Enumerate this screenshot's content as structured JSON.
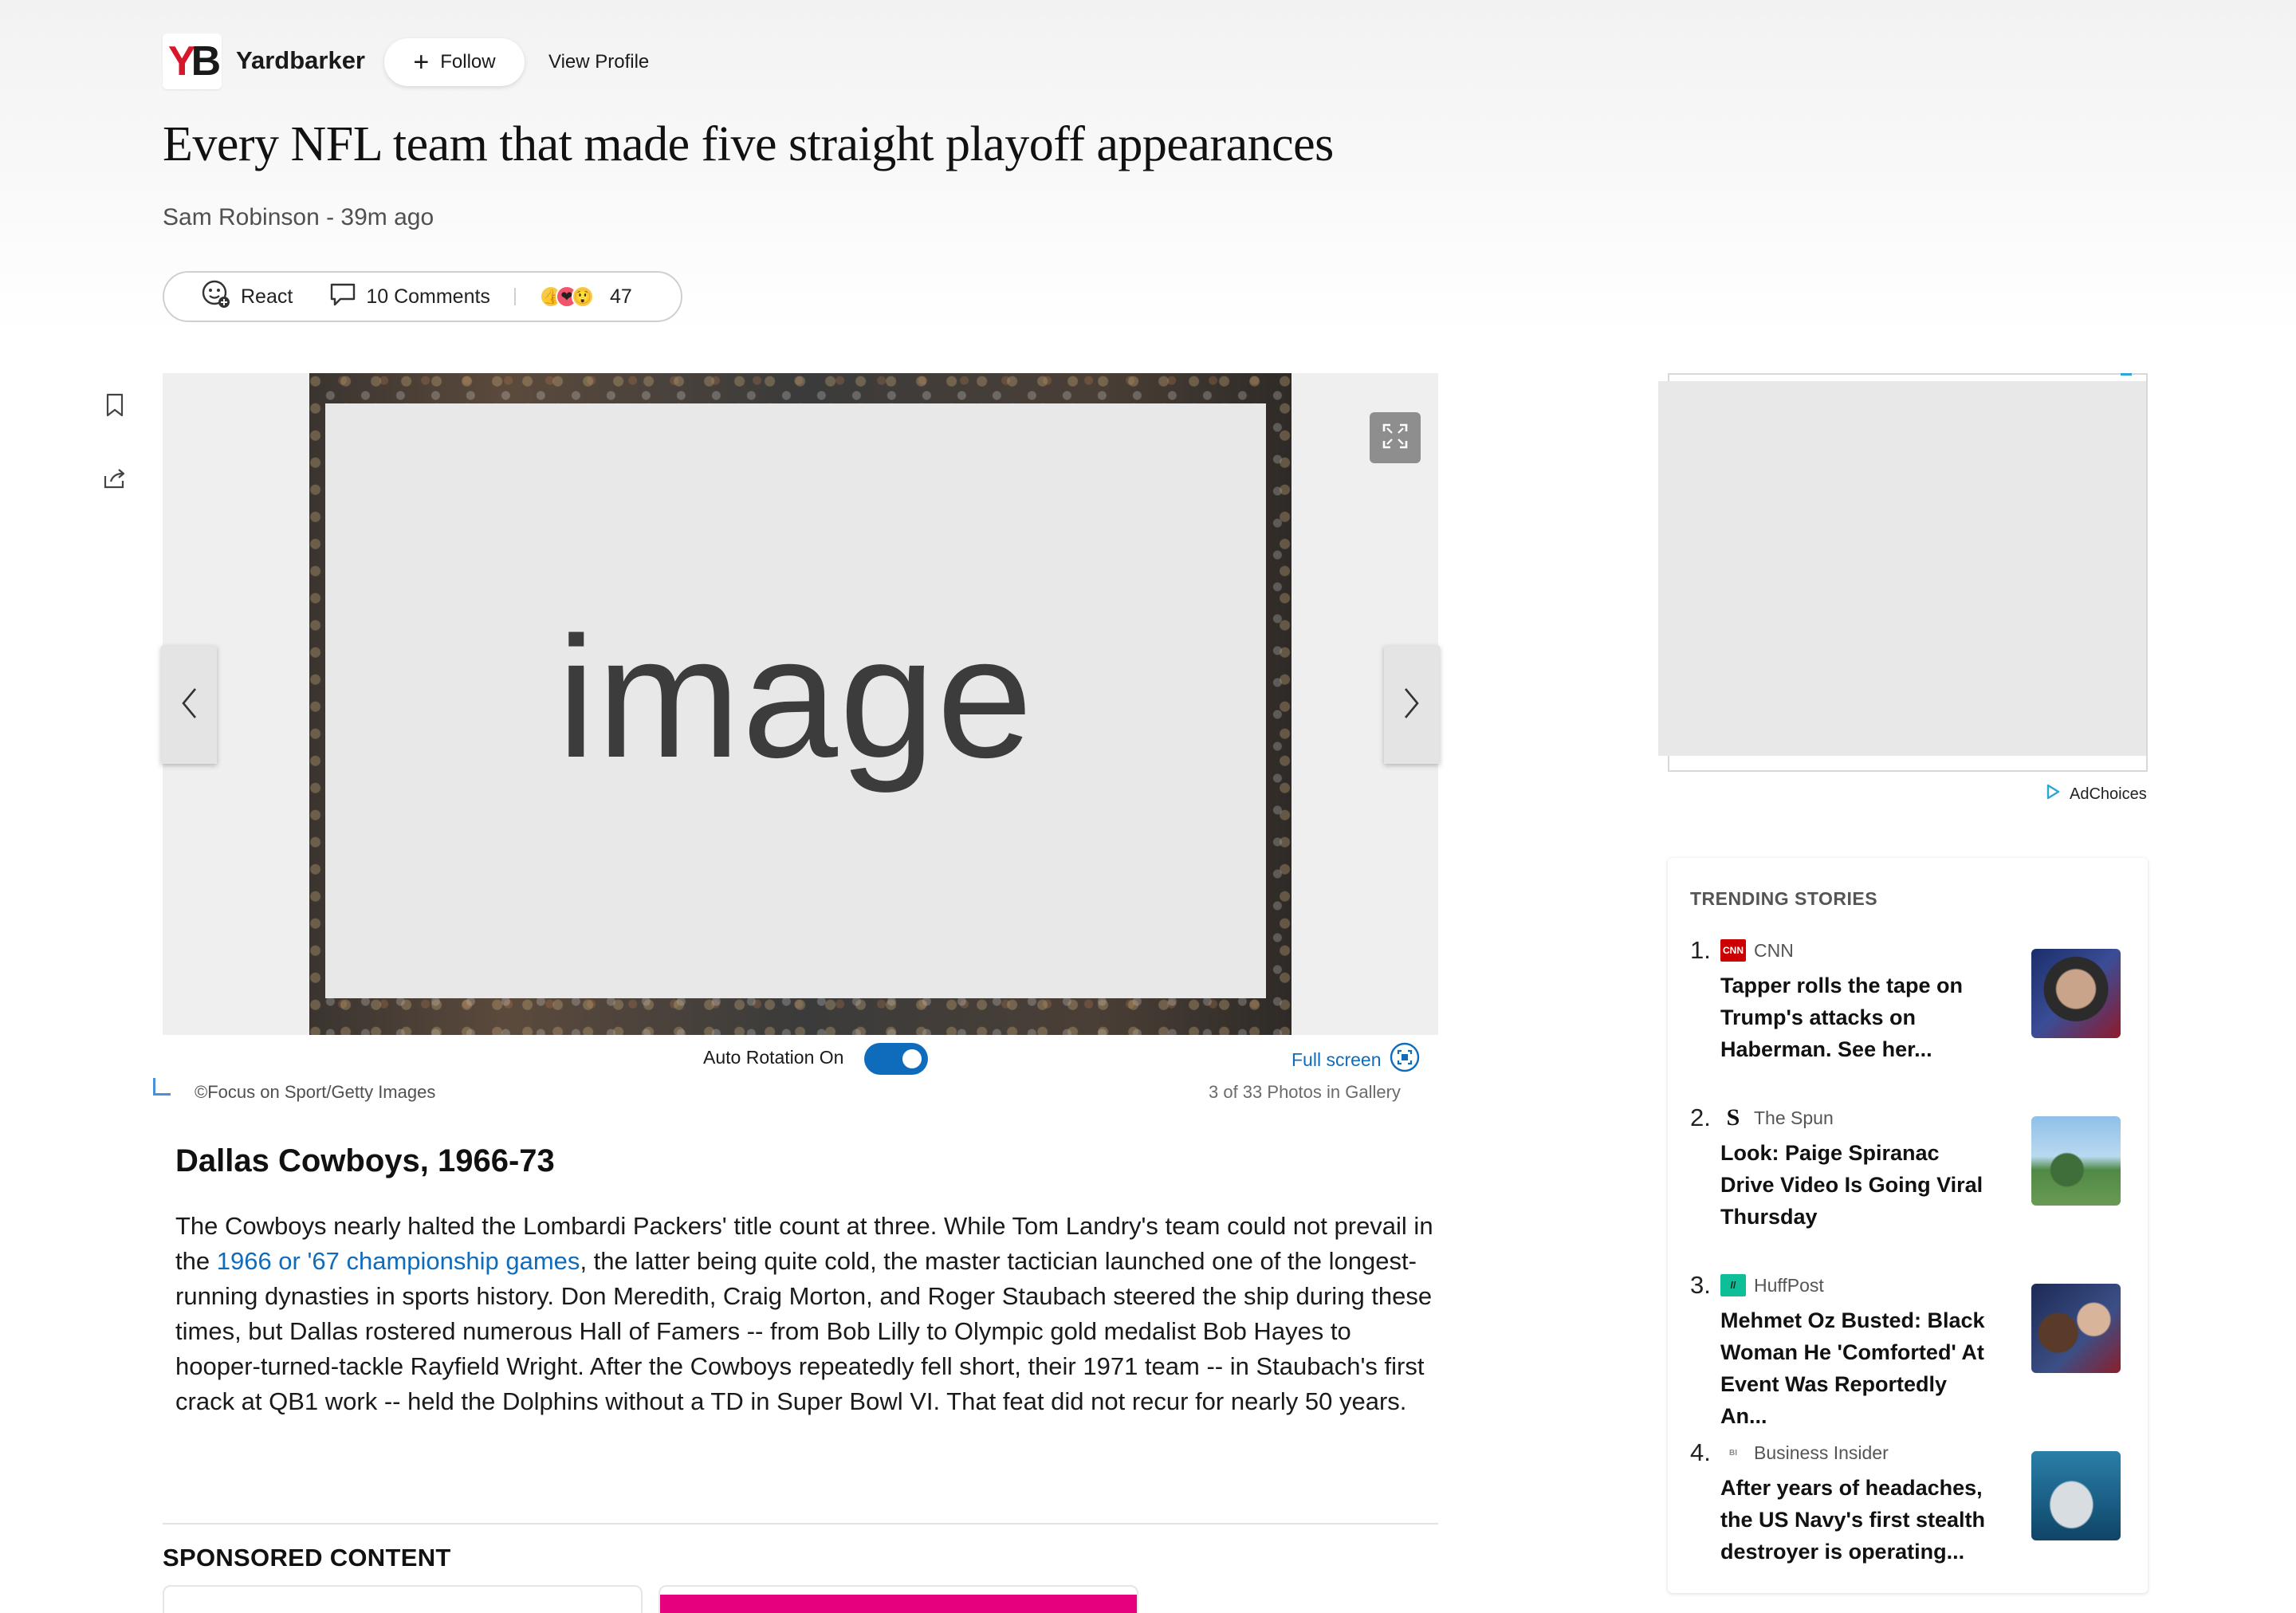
{
  "header": {
    "publisher": "Yardbarker",
    "logo_text": "YB",
    "follow_label": "Follow",
    "view_profile_label": "View Profile"
  },
  "article": {
    "title": "Every NFL team that made five straight playoff appearances",
    "byline": "Sam Robinson - 39m ago",
    "react_label": "React",
    "comments_label": "10 Comments",
    "reaction_count": "47"
  },
  "gallery": {
    "placeholder_text": "image",
    "auto_rotation_label": "Auto Rotation On",
    "fullscreen_label": "Full screen",
    "credit": "©Focus on Sport/Getty Images",
    "photo_count": "3 of 33 Photos in Gallery"
  },
  "slide": {
    "heading": "Dallas Cowboys, 1966-73",
    "body_before_link": "The Cowboys nearly halted the Lombardi Packers' title count at three. While Tom Landry's team could not prevail in the ",
    "link_text": "1966 or '67 championship games",
    "body_after_link": ", the latter being quite cold, the master tactician launched one of the longest-running dynasties in sports history. Don Meredith, Craig Morton, and Roger Staubach steered the ship during these times, but Dallas rostered numerous Hall of Famers -- from Bob Lilly to Olympic gold medalist Bob Hayes to hooper-turned-tackle Rayfield Wright. After the Cowboys repeatedly fell short, their 1971 team -- in Staubach's first crack at QB1 work -- held the Dolphins without a TD in Super Bowl VI. That feat did not recur for nearly 50 years."
  },
  "sponsored": {
    "heading": "SPONSORED CONTENT"
  },
  "ad": {
    "adchoices_label": "AdChoices"
  },
  "trending": {
    "heading": "TRENDING STORIES",
    "items": [
      {
        "rank": "1.",
        "source": "CNN",
        "title": "Tapper rolls the tape on Trump's attacks on Haberman. See her...",
        "logo_color": "#cc0000",
        "logo_text": "CNN"
      },
      {
        "rank": "2.",
        "source": "The Spun",
        "title": "Look: Paige Spiranac Drive Video Is Going Viral Thursday",
        "logo_color": "#ffffff",
        "logo_text": "S"
      },
      {
        "rank": "3.",
        "source": "HuffPost",
        "title": "Mehmet Oz Busted: Black Woman He 'Comforted' At Event Was Reportedly An...",
        "logo_color": "#0dbe98",
        "logo_text": "//"
      },
      {
        "rank": "4.",
        "source": "Business Insider",
        "title": "After years of headaches, the US Navy's first stealth destroyer is operating...",
        "logo_color": "#ffffff",
        "logo_text": "BI"
      }
    ]
  },
  "colors": {
    "accent_blue": "#0f6cbd",
    "brand_red": "#d7182a",
    "sponsored_pink": "#e6007e"
  }
}
